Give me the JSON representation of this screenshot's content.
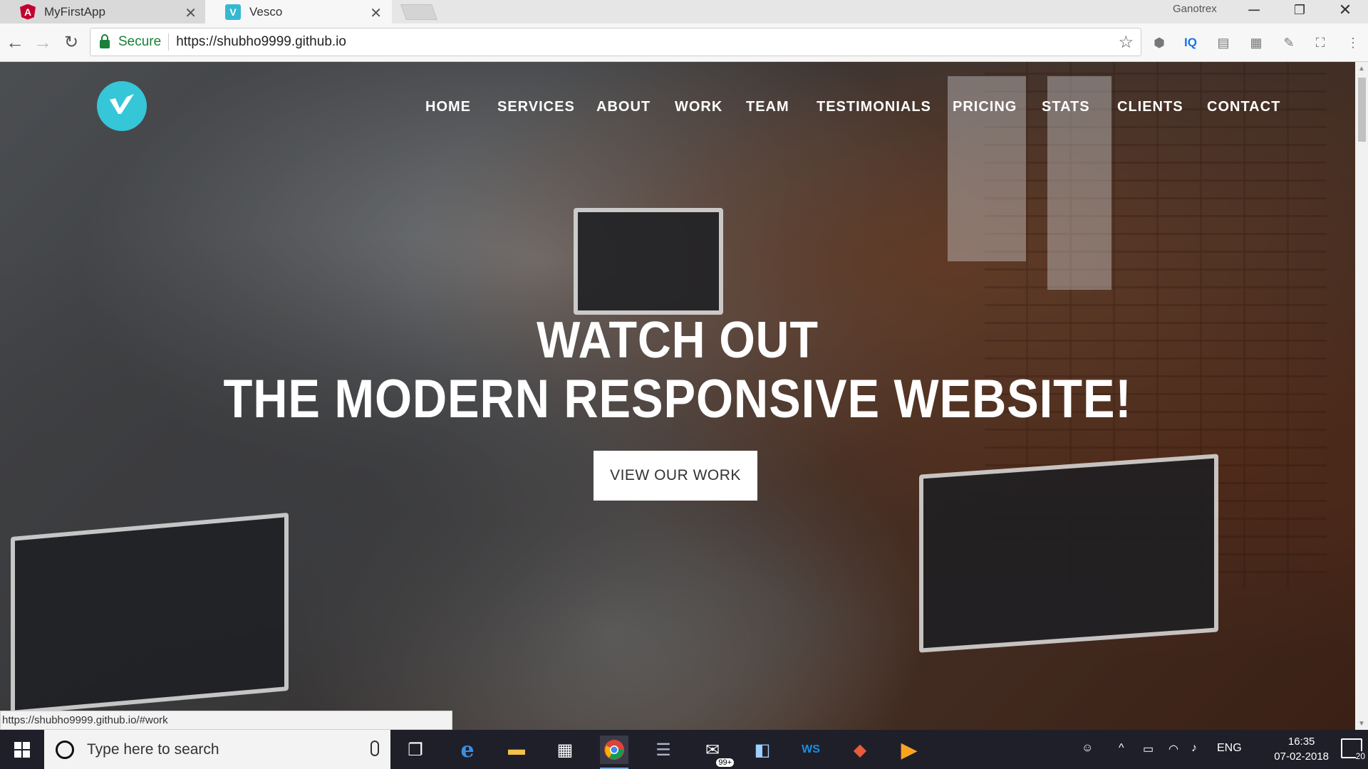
{
  "browser": {
    "tabs": [
      {
        "title": "MyFirstApp",
        "favicon": "angular-icon"
      },
      {
        "title": "Vesco",
        "favicon": "vesco-icon"
      }
    ],
    "profile_name": "Ganotrex",
    "address": {
      "secure_label": "Secure",
      "url": "https://shubho9999.github.io"
    },
    "status_url": "https://shubho9999.github.io/#work"
  },
  "site": {
    "nav": [
      "HOME",
      "SERVICES",
      "ABOUT",
      "WORK",
      "TEAM",
      "TESTIMONIALS",
      "PRICING",
      "STATS",
      "CLIENTS",
      "CONTACT"
    ],
    "hero": {
      "line1": "WATCH OUT",
      "line2": "THE MODERN RESPONSIVE WEBSITE!",
      "cta": "VIEW OUR WORK"
    },
    "colors": {
      "accent": "#35c6d8"
    }
  },
  "taskbar": {
    "search_placeholder": "Type here to search",
    "badge": "99+",
    "language": "ENG",
    "time": "16:35",
    "date": "07-02-2018",
    "notification_count": "20"
  }
}
